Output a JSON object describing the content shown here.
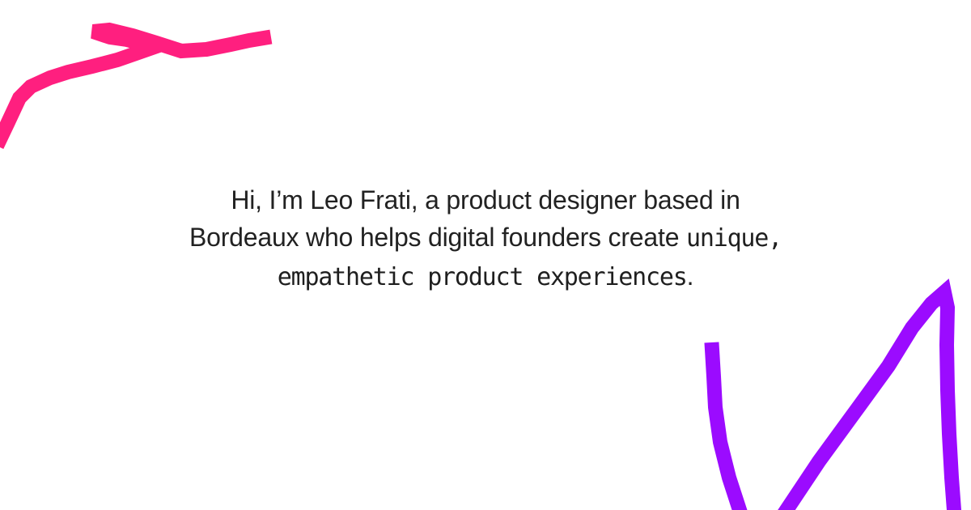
{
  "intro": {
    "line1": "Hi, I’m Leo Frati, a product designer based in",
    "line2_plain": "Bordeaux who helps digital founders create ",
    "line2_pixel": "unique,",
    "line3_pixel": "empathetic product experiences",
    "line3_end": "."
  },
  "decor": {
    "pink_scribble_color": "#FF1F7F",
    "purple_scribble_color": "#9B0BFF"
  }
}
